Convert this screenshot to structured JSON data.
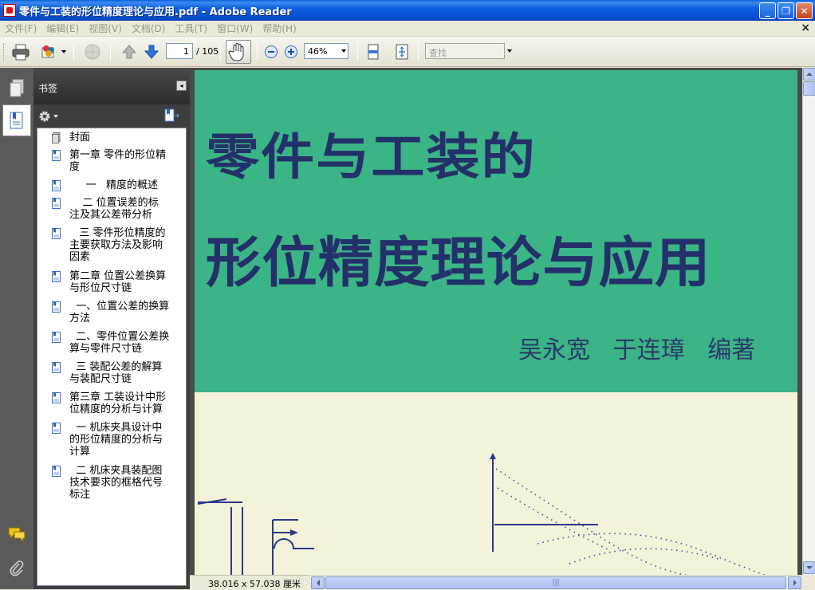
{
  "window": {
    "title": "零件与工装的形位精度理论与应用.pdf - Adobe Reader",
    "minimize": "_",
    "restore": "❐",
    "close": "✕"
  },
  "menu": {
    "items": [
      "文件(F)",
      "编辑(E)",
      "视图(V)",
      "文档(D)",
      "工具(T)",
      "窗口(W)",
      "帮助(H)"
    ],
    "close_glyph": "×"
  },
  "toolbar": {
    "page_current": "1",
    "page_total": "/ 105",
    "zoom": "46%",
    "search_placeholder": "查找"
  },
  "bookmarks": {
    "title": "书签",
    "items": [
      {
        "label": "封面",
        "icon": "page-icon"
      },
      {
        "label": "第一章 零件的形位精\n度",
        "icon": "bookmark-page-icon"
      },
      {
        "label": "     一   精度的概述",
        "icon": "bookmark-page-icon"
      },
      {
        "label": "    二 位置误差的标\n注及其公差带分析",
        "icon": "bookmark-page-icon"
      },
      {
        "label": "   三 零件形位精度的\n主要获取方法及影响\n因素",
        "icon": "bookmark-page-icon"
      },
      {
        "label": "第二章 位置公差换算\n与形位尺寸链",
        "icon": "bookmark-page-icon"
      },
      {
        "label": "  一、位置公差的换算\n方法",
        "icon": "bookmark-page-icon"
      },
      {
        "label": "  二、零件位置公差换\n算与零件尺寸链",
        "icon": "bookmark-page-icon"
      },
      {
        "label": "  三 装配公差的解算\n与装配尺寸链",
        "icon": "bookmark-page-icon"
      },
      {
        "label": "第三章 工装设计中形\n位精度的分析与计算",
        "icon": "bookmark-page-icon"
      },
      {
        "label": "  一 机床夹具设计中\n的形位精度的分析与\n计算",
        "icon": "bookmark-page-icon"
      },
      {
        "label": "  二 机床夹具装配图\n技术要求的框格代号\n标注",
        "icon": "bookmark-page-icon"
      }
    ]
  },
  "document": {
    "cover_line1": "零件与工装的",
    "cover_line2": "形位精度理论与应用",
    "cover_authors": "吴永宽   于连璋   编著",
    "page_size": "38.016 x 57.038 厘米"
  },
  "colors": {
    "cover_green": "#3bb486",
    "cover_cream": "#f4f2d8",
    "title_navy": "#24306a"
  }
}
